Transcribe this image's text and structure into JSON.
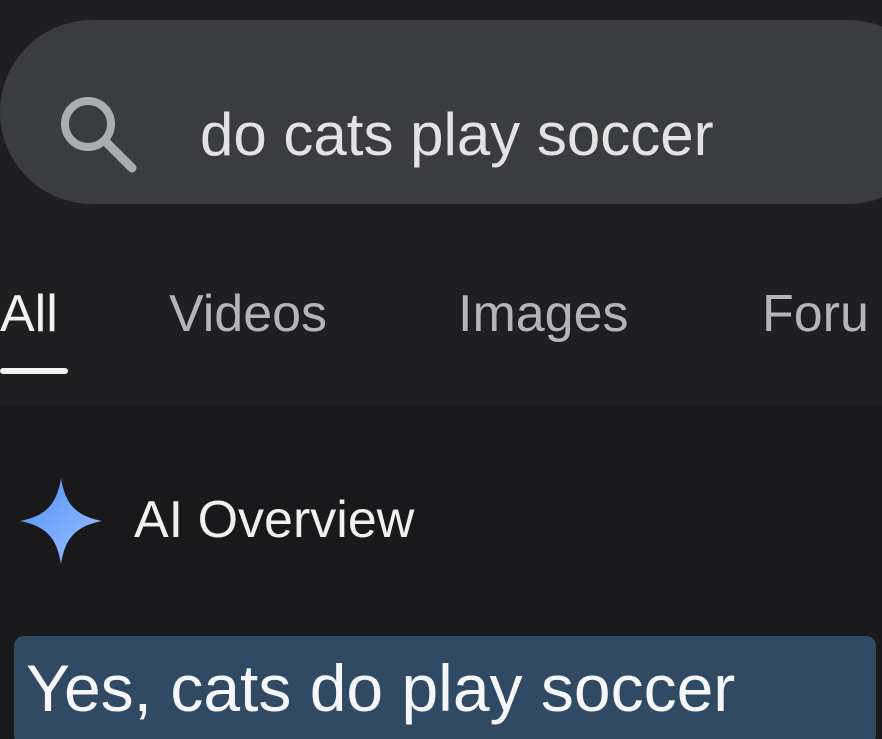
{
  "search": {
    "query": "do cats play soccer"
  },
  "tabs": [
    {
      "label": "All",
      "active": true
    },
    {
      "label": "Videos",
      "active": false
    },
    {
      "label": "Images",
      "active": false
    },
    {
      "label": "Foru",
      "active": false
    }
  ],
  "ai_overview": {
    "title": "AI Overview",
    "answer": "Yes, cats do play soccer"
  },
  "icons": {
    "search": "search-icon",
    "ai_overview": "sparkle-icon"
  },
  "colors": {
    "background": "#1f1f21",
    "content_background": "#19191b",
    "search_bar": "#3a3c40",
    "highlight": "#304a63",
    "sparkle_gradient": [
      "#4f8ff7",
      "#9cc3ff"
    ]
  }
}
